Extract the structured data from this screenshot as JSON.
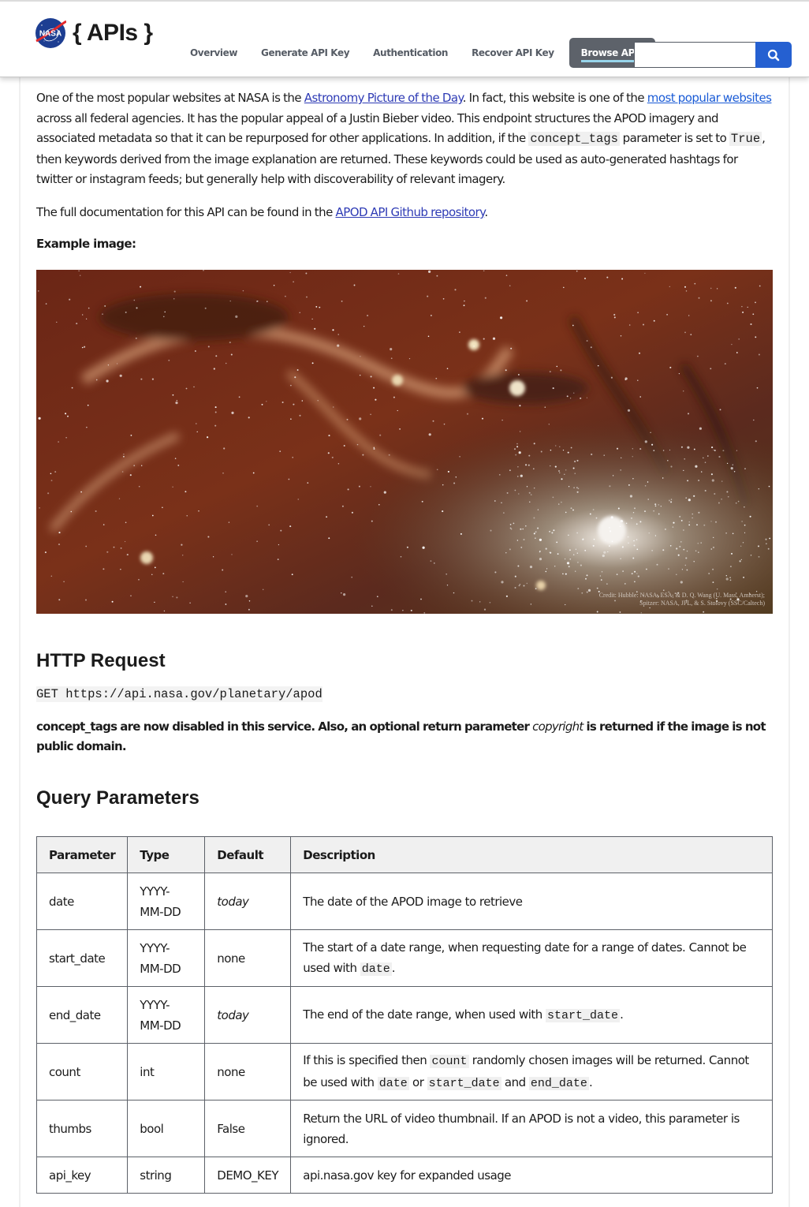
{
  "header": {
    "logo_alt": "NASA",
    "brand": "{ APIs }",
    "nav": [
      {
        "label": "Overview",
        "active": false
      },
      {
        "label": "Generate API Key",
        "active": false
      },
      {
        "label": "Authentication",
        "active": false
      },
      {
        "label": "Recover API Key",
        "active": false
      },
      {
        "label": "Browse APIs",
        "active": true
      }
    ],
    "search": {
      "value": "",
      "placeholder": "",
      "button_icon": "search-icon"
    },
    "colors": {
      "search_button": "#2560d1",
      "active_nav_bg": "#5d626a",
      "active_underline": "#97d4ea"
    }
  },
  "intro": {
    "p1_a": "One of the most popular websites at NASA is the ",
    "p1_link1": "Astronomy Picture of the Day",
    "p1_b": ". In fact, this website is one of the ",
    "p1_link2": "most popular websites",
    "p1_c": " across all federal agencies. It has the popular appeal of a Justin Bieber video. This endpoint structures the APOD imagery and associated metadata so that it can be repurposed for other applications. In addition, if the ",
    "p1_code1": "concept_tags",
    "p1_d": " parameter is set to ",
    "p1_code2": "True",
    "p1_e": ", then keywords derived from the image explanation are returned. These keywords could be used as auto-generated hashtags for twitter or instagram feeds; but generally help with discoverability of relevant imagery.",
    "p2_a": "The full documentation for this API can be found in the ",
    "p2_link": "APOD API Github repository",
    "p2_b": "."
  },
  "example": {
    "label": "Example image:",
    "image_alt": "Milky Way galactic center composite",
    "credit_line1": "Credit: Hubble: NASA, ESA, & D. Q. Wang (U. Mass, Amherst);",
    "credit_line2": "Spitzer: NASA, JPL, & S. Stolovy (SSC/Caltech)"
  },
  "http_request": {
    "heading": "HTTP Request",
    "endpoint": "GET https://api.nasa.gov/planetary/apod",
    "notice_a": "concept_tags are now disabled in this service. Also, an optional return parameter ",
    "notice_em": "copyright",
    "notice_b": " is returned if the image is not public domain."
  },
  "query_parameters": {
    "heading": "Query Parameters",
    "columns": [
      "Parameter",
      "Type",
      "Default",
      "Description"
    ],
    "rows": [
      {
        "param": "date",
        "type": "YYYY-MM-DD",
        "default": "today",
        "default_italic": true,
        "desc": [
          {
            "t": "The date of the APOD image to retrieve"
          }
        ]
      },
      {
        "param": "start_date",
        "type": "YYYY-MM-DD",
        "default": "none",
        "default_italic": false,
        "desc": [
          {
            "t": "The start of a date range, when requesting date for a range of dates. Cannot be used with "
          },
          {
            "code": "date"
          },
          {
            "t": "."
          }
        ]
      },
      {
        "param": "end_date",
        "type": "YYYY-MM-DD",
        "default": "today",
        "default_italic": true,
        "desc": [
          {
            "t": "The end of the date range, when used with "
          },
          {
            "code": "start_date"
          },
          {
            "t": "."
          }
        ]
      },
      {
        "param": "count",
        "type": "int",
        "default": "none",
        "default_italic": false,
        "desc": [
          {
            "t": "If this is specified then "
          },
          {
            "code": "count"
          },
          {
            "t": " randomly chosen images will be returned. Cannot be used with "
          },
          {
            "code": "date"
          },
          {
            "t": " or "
          },
          {
            "code": "start_date"
          },
          {
            "t": " and "
          },
          {
            "code": "end_date"
          },
          {
            "t": "."
          }
        ]
      },
      {
        "param": "thumbs",
        "type": "bool",
        "default": "False",
        "default_italic": false,
        "desc": [
          {
            "t": "Return the URL of video thumbnail. If an APOD is not a video, this parameter is ignored."
          }
        ]
      },
      {
        "param": "api_key",
        "type": "string",
        "default": "DEMO_KEY",
        "default_italic": false,
        "desc": [
          {
            "t": "api.nasa.gov key for expanded usage"
          }
        ]
      }
    ]
  }
}
